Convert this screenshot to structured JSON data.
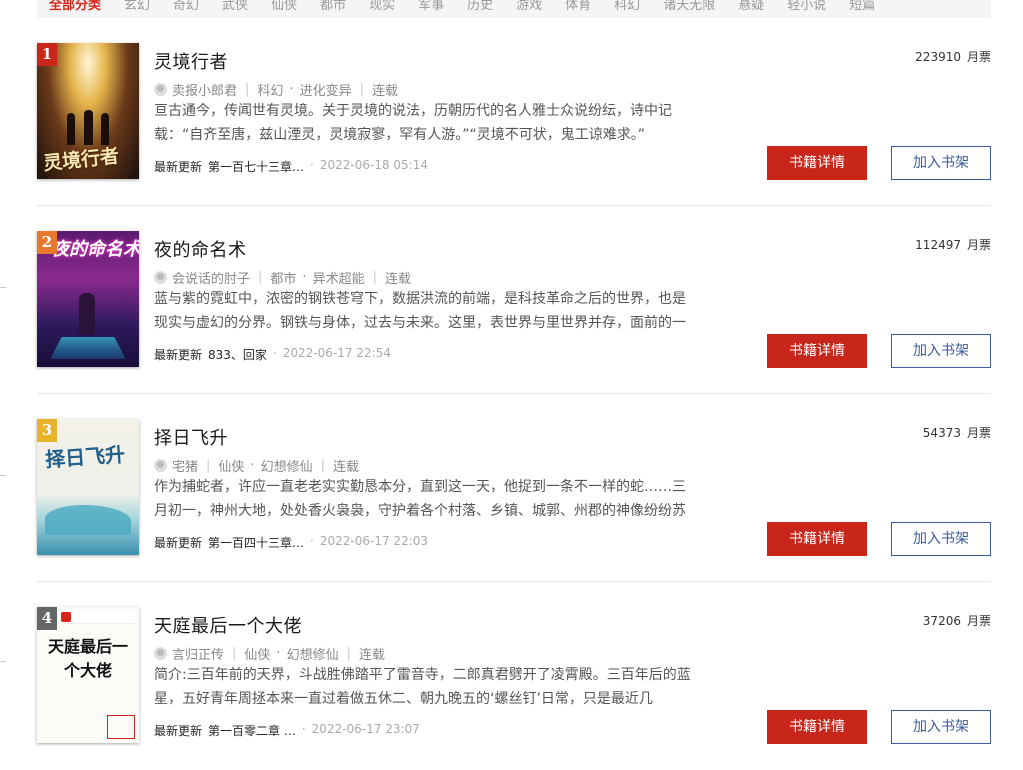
{
  "tabs": [
    "全部分类",
    "玄幻",
    "奇幻",
    "武侠",
    "仙侠",
    "都市",
    "现实",
    "军事",
    "历史",
    "游戏",
    "体育",
    "科幻",
    "诸天无限",
    "悬疑",
    "轻小说",
    "短篇"
  ],
  "colors": {
    "brand_red": "#c8251b",
    "button_blue": "#3a5b9f",
    "rank_colors": [
      "#c8251b",
      "#e8782d",
      "#e8b22a",
      "#666666"
    ]
  },
  "buttons": {
    "detail": "书籍详情",
    "add": "加入书架"
  },
  "update_label": "最新更新",
  "vote_unit": "月票",
  "books": [
    {
      "rank": "1",
      "title": "灵境行者",
      "author": "卖报小郎君",
      "genre": "科幻",
      "subgenre": "进化变异",
      "status": "连载",
      "desc": "亘古通今，传闻世有灵境。关于灵境的说法，历朝历代的名人雅士众说纷纭，诗中记载：“自齐至唐，兹山湮灵，灵境寂寥，罕有人游。”“灵境不可状，鬼工谅难求。”",
      "latest": "第一百七十三章…",
      "time": "2022-06-18 05:14",
      "votes": "223910",
      "cover_text": "灵境行者"
    },
    {
      "rank": "2",
      "title": "夜的命名术",
      "author": "会说话的肘子",
      "genre": "都市",
      "subgenre": "异术超能",
      "status": "连载",
      "desc": "蓝与紫的霓虹中，浓密的钢铁苍穹下，数据洪流的前端，是科技革命之后的世界，也是现实与虚幻的分界。钢铁与身体，过去与未来。这里，表世界与里世界并存，面前的一",
      "latest": "833、回家",
      "time": "2022-06-17 22:54",
      "votes": "112497",
      "cover_text": "夜的命名术"
    },
    {
      "rank": "3",
      "title": "择日飞升",
      "author": "宅猪",
      "genre": "仙侠",
      "subgenre": "幻想修仙",
      "status": "连载",
      "desc": "作为捕蛇者，许应一直老老实实勤恳本分，直到这一天，他捉到一条不一样的蛇……三月初一，神州大地，处处香火袅袅，守护着各个村落、乡镇、城郭、州郡的神像纷纷苏",
      "latest": "第一百四十三章…",
      "time": "2022-06-17 22:03",
      "votes": "54373",
      "cover_text": "择日飞升"
    },
    {
      "rank": "4",
      "title": "天庭最后一个大佬",
      "author": "言归正传",
      "genre": "仙侠",
      "subgenre": "幻想修仙",
      "status": "连载",
      "desc": "简介:三百年前的天界，斗战胜佛踏平了雷音寺，二郎真君劈开了凌霄殿。三百年后的蓝星，五好青年周拯本来一直过着做五休二、朝九晚五的‘螺丝钉’日常，只是最近几",
      "latest": "第一百零二章 …",
      "time": "2022-06-17 23:07",
      "votes": "37206",
      "cover_text": "天庭最后一个大佬"
    }
  ]
}
